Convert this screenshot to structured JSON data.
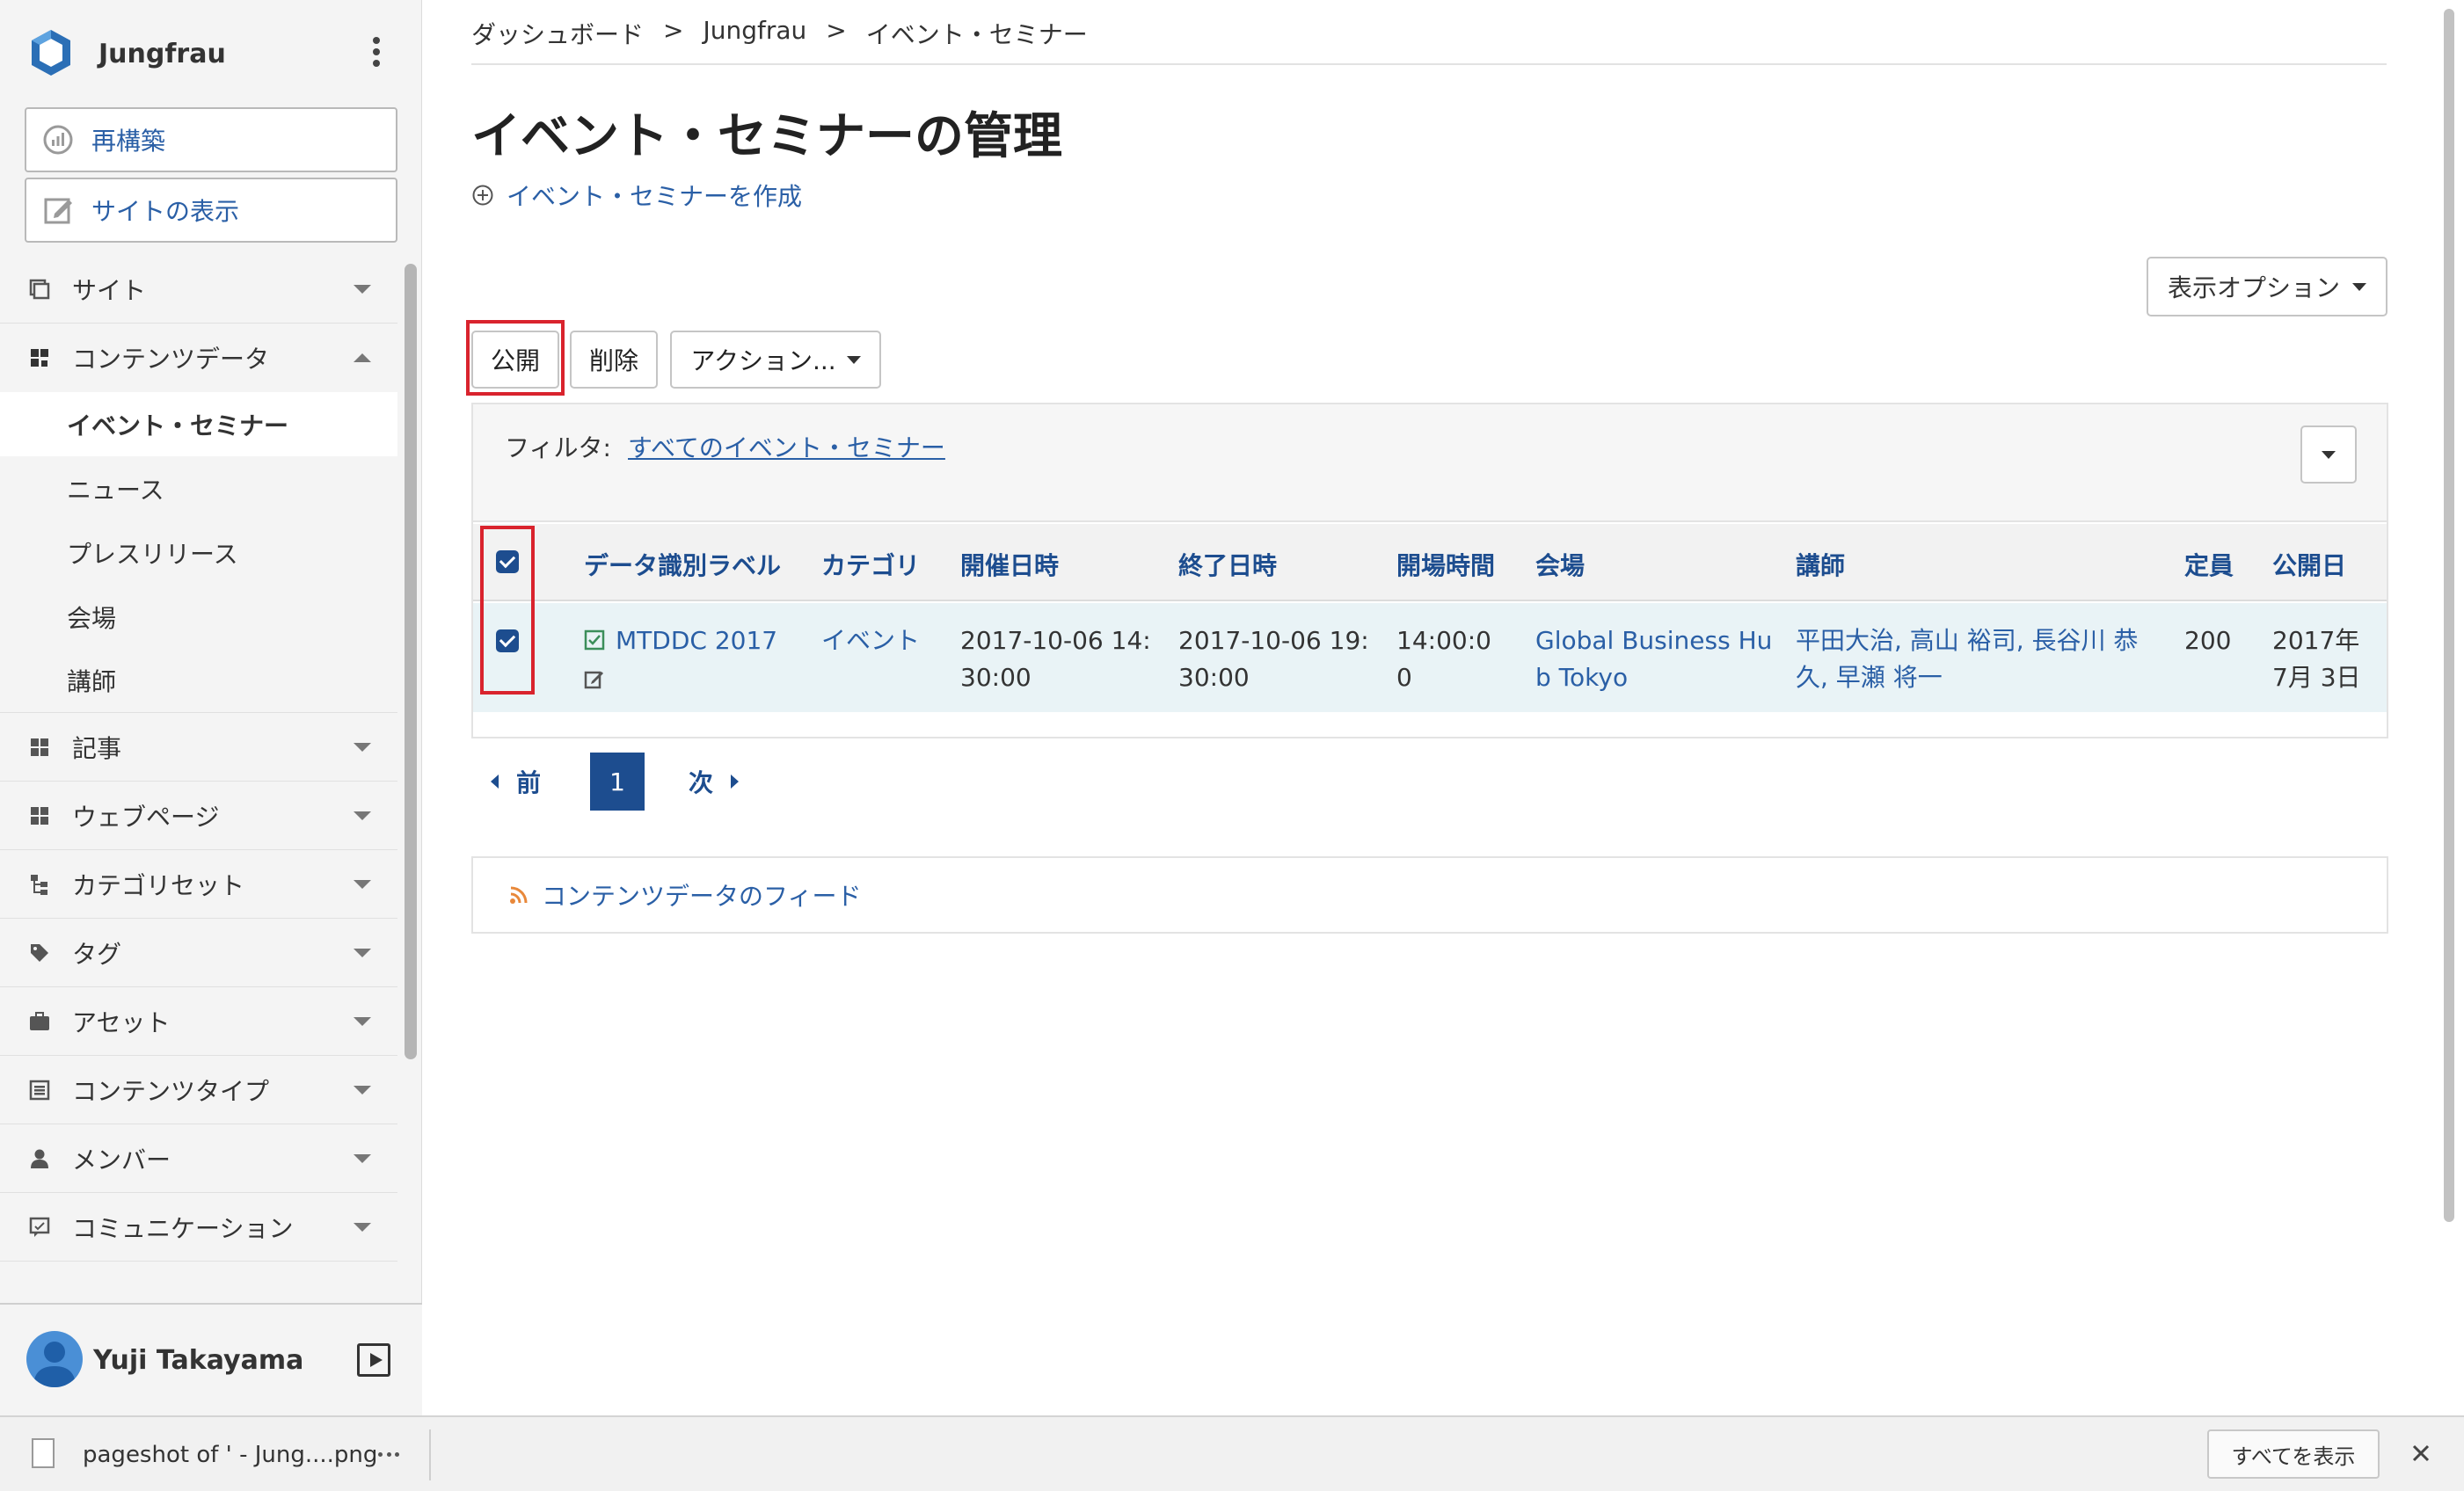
{
  "site": {
    "name": "Jungfrau"
  },
  "sidebar": {
    "rebuild_label": "再構築",
    "view_site_label": "サイトの表示",
    "nav": [
      {
        "label": "サイト"
      },
      {
        "label": "コンテンツデータ"
      },
      {
        "label": "記事"
      },
      {
        "label": "ウェブページ"
      },
      {
        "label": "カテゴリセット"
      },
      {
        "label": "タグ"
      },
      {
        "label": "アセット"
      },
      {
        "label": "コンテンツタイプ"
      },
      {
        "label": "メンバー"
      },
      {
        "label": "コミュニケーション"
      }
    ],
    "content_data_sub": [
      {
        "label": "イベント・セミナー"
      },
      {
        "label": "ニュース"
      },
      {
        "label": "プレスリリース"
      },
      {
        "label": "会場"
      },
      {
        "label": "講師"
      }
    ]
  },
  "user": {
    "name": "Yuji Takayama"
  },
  "breadcrumb": [
    {
      "label": "ダッシュボード"
    },
    {
      "sep": ">"
    },
    {
      "label": "Jungfrau"
    },
    {
      "sep": ">"
    },
    {
      "label": "イベント・セミナー"
    }
  ],
  "page": {
    "title": "イベント・セミナーの管理",
    "create_label": "イベント・セミナーを作成",
    "display_options_label": "表示オプション"
  },
  "actions": {
    "publish": "公開",
    "delete": "削除",
    "more": "アクション..."
  },
  "filter": {
    "label": "フィルタ:",
    "value": "すべてのイベント・セミナー"
  },
  "table": {
    "columns": [
      "データ識別ラベル",
      "カテゴリ",
      "開催日時",
      "終了日時",
      "開場時間",
      "会場",
      "講師",
      "定員",
      "公開日"
    ],
    "rows": [
      {
        "label": "MTDDC 2017",
        "category": "イベント",
        "start_line1": "2017-10-06 14:",
        "start_line2": "30:00",
        "end_line1": "2017-10-06 19:",
        "end_line2": "30:00",
        "open_line1": "14:00:0",
        "open_line2": "0",
        "venue_line1": "Global Business Hu",
        "venue_line2": "b Tokyo",
        "speakers_line1": "平田大治, 高山 裕司, 長谷川 恭",
        "speakers_line2": "久, 早瀬 将一",
        "capacity": "200",
        "published_line1": "2017年",
        "published_line2": "7月 3日"
      }
    ]
  },
  "pagination": {
    "prev": "前",
    "current": "1",
    "next": "次"
  },
  "feed": {
    "label": "コンテンツデータのフィード"
  },
  "download_bar": {
    "filename": "pageshot of ' - Jung....png",
    "show_all": "すべてを表示"
  },
  "colors": {
    "accent": "#1d4d8f",
    "link": "#2a5fa6",
    "highlight": "#d9232d",
    "feed_icon": "#e8883a"
  }
}
